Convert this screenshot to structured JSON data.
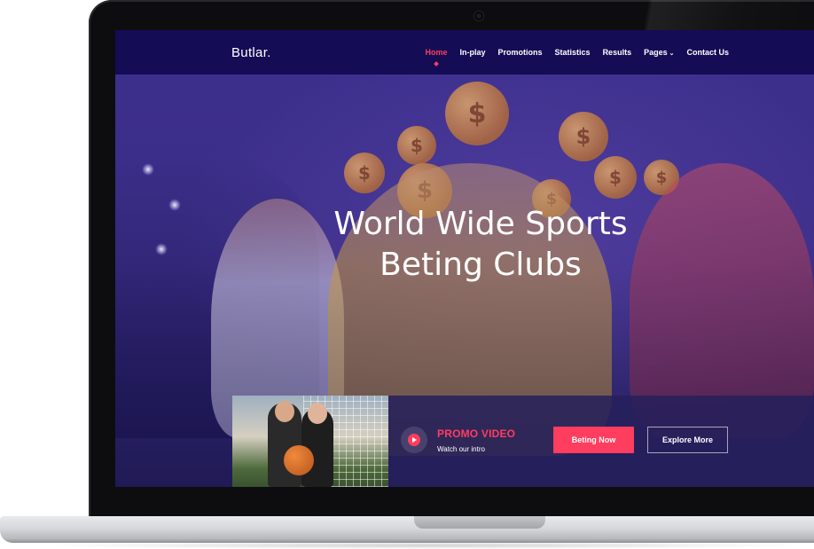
{
  "site": {
    "logo": "Butlar."
  },
  "nav": {
    "items": [
      {
        "label": "Home",
        "active": true
      },
      {
        "label": "In-play"
      },
      {
        "label": "Promotions"
      },
      {
        "label": "Statistics"
      },
      {
        "label": "Results"
      },
      {
        "label": "Pages",
        "has_dropdown": true
      },
      {
        "label": "Contact Us"
      }
    ],
    "dropdown_icon": "chevron-down-icon"
  },
  "hero": {
    "title_line1": "World Wide Sports",
    "title_line2": "Beting Clubs"
  },
  "promo": {
    "title": "PROMO VIDEO",
    "subtitle": "Watch our intro",
    "play_icon": "play-icon"
  },
  "buttons": {
    "primary": "Beting Now",
    "secondary": "Explore More"
  },
  "colors": {
    "accent": "#ff3d5e",
    "navbar": "#140c55",
    "hero_overlay": "#3a2d86"
  }
}
